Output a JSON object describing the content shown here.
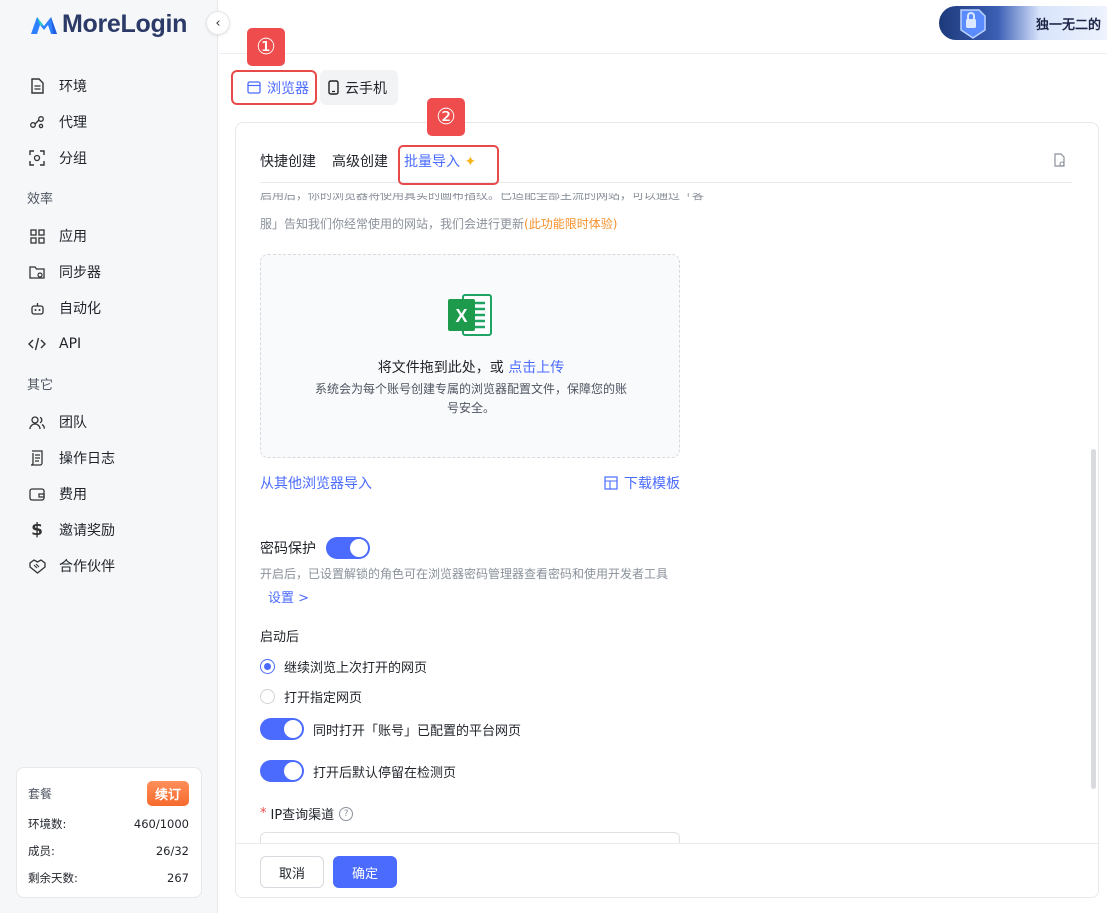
{
  "app": {
    "logo_text": "MoreLogin"
  },
  "sidebar": {
    "items": [
      {
        "label": "环境",
        "icon": "document-icon"
      },
      {
        "label": "代理",
        "icon": "proxy-icon"
      },
      {
        "label": "分组",
        "icon": "group-icon"
      }
    ],
    "section_efficiency": "效率",
    "efficiency_items": [
      {
        "label": "应用",
        "icon": "apps-grid-icon"
      },
      {
        "label": "同步器",
        "icon": "sync-folder-icon"
      },
      {
        "label": "自动化",
        "icon": "robot-icon"
      },
      {
        "label": "API",
        "icon": "code-icon"
      }
    ],
    "section_other": "其它",
    "other_items": [
      {
        "label": "团队",
        "icon": "team-icon"
      },
      {
        "label": "操作日志",
        "icon": "log-scroll-icon"
      },
      {
        "label": "费用",
        "icon": "wallet-icon"
      },
      {
        "label": "邀请奖励",
        "icon": "dollar-icon"
      },
      {
        "label": "合作伙伴",
        "icon": "handshake-icon"
      }
    ],
    "plan": {
      "title": "套餐",
      "renew": "续订",
      "rows": [
        {
          "label": "环境数:",
          "value": "460/1000"
        },
        {
          "label": "成员:",
          "value": "26/32"
        },
        {
          "label": "剩余天数:",
          "value": "267"
        }
      ]
    }
  },
  "topbar": {
    "promo_text": "独一无二的"
  },
  "device_tabs": {
    "browser": "浏览器",
    "phone": "云手机"
  },
  "badges": {
    "one": "①",
    "two": "②"
  },
  "tabs": {
    "quick": "快捷创建",
    "advanced": "高级创建",
    "batch": "批量导入"
  },
  "description": {
    "top_cut": "启用后，你的浏览器将使用真实的画布指纹。已适配全部主流的网站，可以通过「客",
    "line2": "服」告知我们你经常使用的网站，我们会进行更新",
    "orange": "(此功能限时体验)"
  },
  "upload": {
    "main_text": "将文件拖到此处，或 ",
    "link_text": "点击上传",
    "sub_text": "系统会为每个账号创建专属的浏览器配置文件，保障您的账号安全。"
  },
  "links": {
    "import_other": "从其他浏览器导入",
    "download_template": "下载模板"
  },
  "password": {
    "label": "密码保护",
    "enabled": true,
    "desc": "开启后，已设置解锁的角色可在浏览器密码管理器查看密码和使用开发者工具",
    "settings": "设置 >"
  },
  "launch": {
    "label": "启动后",
    "options": [
      {
        "label": "继续浏览上次打开的网页",
        "selected": true
      },
      {
        "label": "打开指定网页",
        "selected": false
      }
    ],
    "switches": [
      {
        "label": "同时打开「账号」已配置的平台网页",
        "on": true
      },
      {
        "label": "打开后默认停留在检测页",
        "on": true
      }
    ]
  },
  "ip": {
    "label": "IP查询渠道",
    "required": "*"
  },
  "footer": {
    "cancel": "取消",
    "confirm": "确定"
  },
  "colors": {
    "accent": "#4b6bff",
    "highlight": "#e84a4a",
    "orange": "#f5902a"
  }
}
